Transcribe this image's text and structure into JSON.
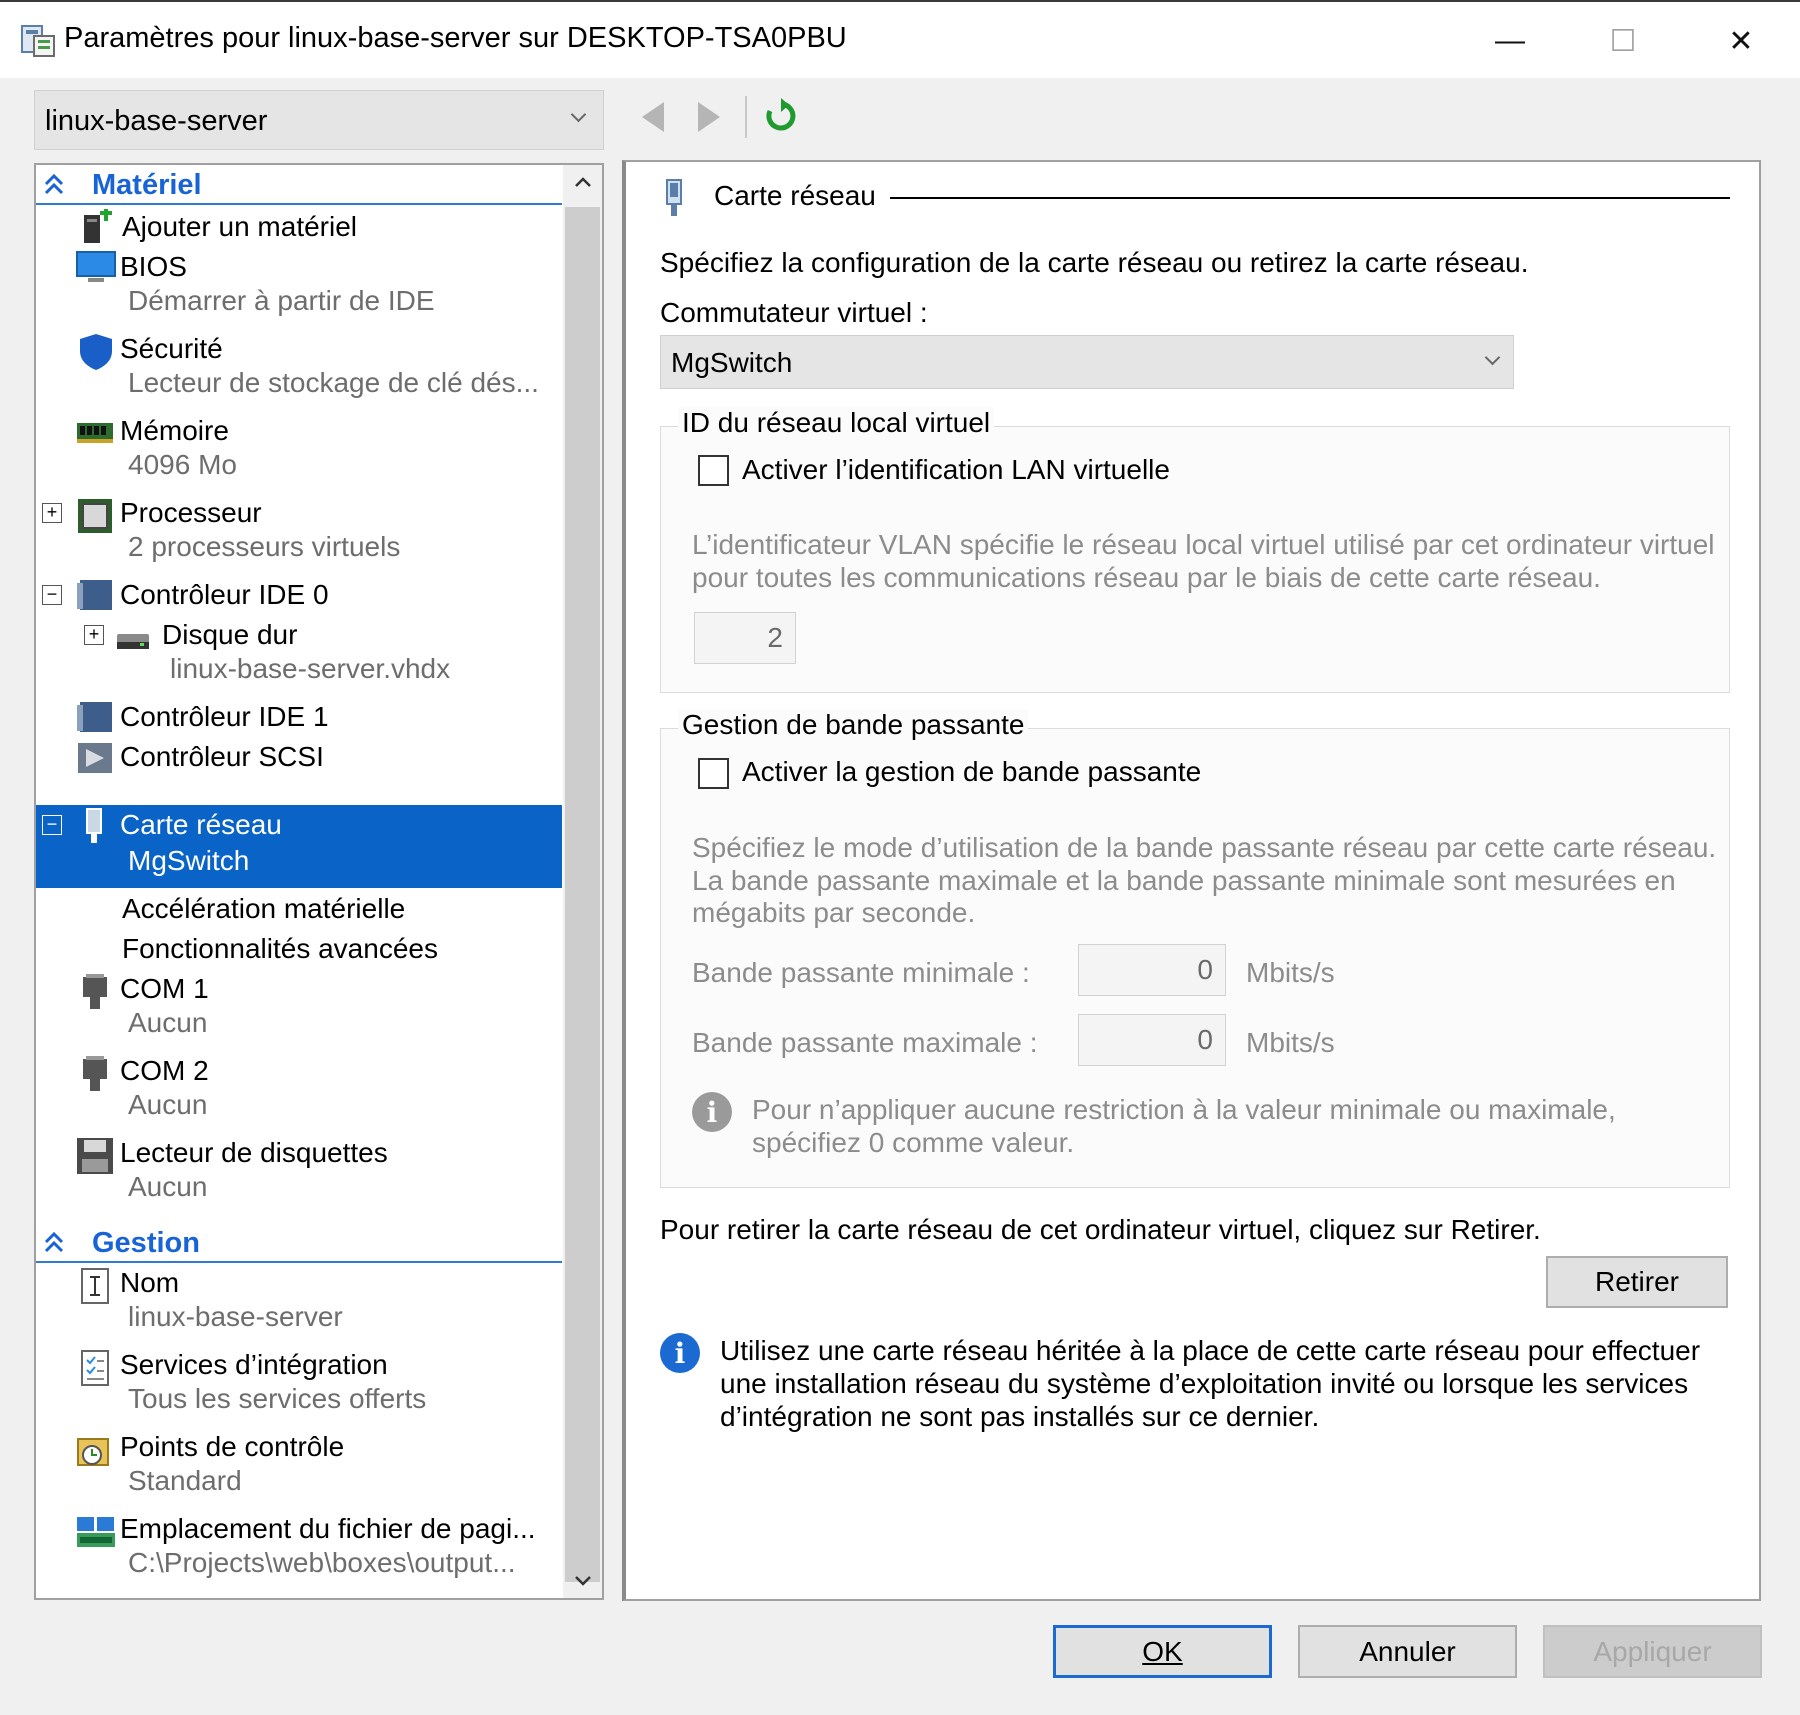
{
  "window": {
    "title": "Paramètres pour linux-base-server sur DESKTOP-TSA0PBU",
    "minimize_glyph": "—",
    "maximize_glyph": "☐",
    "close_glyph": "✕"
  },
  "vm_selector": {
    "value": "linux-base-server"
  },
  "tree": {
    "hardware_header": "Matériel",
    "management_header": "Gestion",
    "items": [
      {
        "label": "Ajouter un matériel",
        "sub": ""
      },
      {
        "label": "BIOS",
        "sub": "Démarrer à partir de IDE"
      },
      {
        "label": "Sécurité",
        "sub": "Lecteur de stockage de clé dés..."
      },
      {
        "label": "Mémoire",
        "sub": "4096 Mo"
      },
      {
        "label": "Processeur",
        "sub": "2 processeurs virtuels"
      },
      {
        "label": "Contrôleur IDE 0",
        "sub": ""
      },
      {
        "label": "Disque dur",
        "sub": "linux-base-server.vhdx"
      },
      {
        "label": "Contrôleur IDE 1",
        "sub": ""
      },
      {
        "label": "Contrôleur SCSI",
        "sub": ""
      },
      {
        "label": "Carte réseau",
        "sub": "MgSwitch"
      },
      {
        "label": "Accélération matérielle",
        "sub": ""
      },
      {
        "label": "Fonctionnalités avancées",
        "sub": ""
      },
      {
        "label": "COM 1",
        "sub": "Aucun"
      },
      {
        "label": "COM 2",
        "sub": "Aucun"
      },
      {
        "label": "Lecteur de disquettes",
        "sub": "Aucun"
      }
    ],
    "management_items": [
      {
        "label": "Nom",
        "sub": "linux-base-server"
      },
      {
        "label": "Services d’intégration",
        "sub": "Tous les services offerts"
      },
      {
        "label": "Points de contrôle",
        "sub": "Standard"
      },
      {
        "label": "Emplacement du fichier de pagi...",
        "sub": "C:\\Projects\\web\\boxes\\output..."
      }
    ],
    "selected_index": 9
  },
  "detail": {
    "section_title": "Carte réseau",
    "description": "Spécifiez la configuration de la carte réseau ou retirez la carte réseau.",
    "switch_label": "Commutateur virtuel :",
    "switch_value": "MgSwitch",
    "vlan": {
      "group_title": "ID du réseau local virtuel",
      "checkbox_label": "Activer l’identification LAN virtuelle",
      "checked": false,
      "help_line1": "L’identificateur VLAN spécifie le réseau local virtuel utilisé par cet ordinateur virtuel",
      "help_line2": "pour toutes les communications réseau par le biais de cette carte réseau.",
      "value": "2"
    },
    "bandwidth": {
      "group_title": "Gestion de bande passante",
      "checkbox_label": "Activer la gestion de bande passante",
      "checked": false,
      "help_line1": "Spécifiez le mode d’utilisation de la bande passante réseau par cette carte réseau.",
      "help_line2": "La bande passante maximale et la bande passante minimale sont mesurées en",
      "help_line3": "mégabits par seconde.",
      "min_label": "Bande passante minimale :",
      "min_value": "0",
      "max_label": "Bande passante maximale :",
      "max_value": "0",
      "unit": "Mbits/s",
      "note_line1": "Pour n’appliquer aucune restriction à la valeur minimale ou maximale,",
      "note_line2": "spécifiez 0 comme valeur."
    },
    "remove_text": "Pour retirer la carte réseau de cet ordinateur virtuel, cliquez sur Retirer.",
    "remove_button": "Retirer",
    "legacy_info_line1": "Utilisez une carte réseau héritée à la place de cette carte réseau pour effectuer",
    "legacy_info_line2": "une installation réseau du système d’exploitation invité ou lorsque les services",
    "legacy_info_line3": "d’intégration ne sont pas installés sur ce dernier."
  },
  "footer": {
    "ok": "OK",
    "cancel": "Annuler",
    "apply": "Appliquer"
  },
  "colors": {
    "accent": "#0a64c8",
    "header_blue": "#1864d6",
    "disabled_text": "#8c8c8c"
  }
}
